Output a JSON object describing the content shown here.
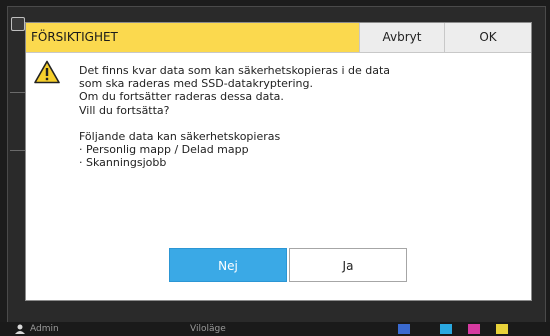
{
  "dialog": {
    "title": "FÖRSIKTIGHET",
    "cancel_label": "Avbryt",
    "ok_label": "OK",
    "icon": "warning-icon",
    "message_lines": [
      "Det finns kvar data som kan säkerhetskopieras i de data",
      "som ska raderas med SSD-datakryptering.",
      "Om du fortsätter raderas dessa data.",
      "Vill du fortsätta?"
    ],
    "backup_heading": "Följande data kan säkerhetskopieras",
    "backup_items": [
      "· Personlig mapp / Delad mapp",
      "· Skanningsjobb"
    ],
    "no_label": "Nej",
    "yes_label": "Ja"
  },
  "status_bar": {
    "user": "Admin",
    "mode": "Viloläge"
  },
  "colors": {
    "title_bar": "#fbd94e",
    "primary_button": "#3aa9e6",
    "header_buttons": "#ededed"
  }
}
